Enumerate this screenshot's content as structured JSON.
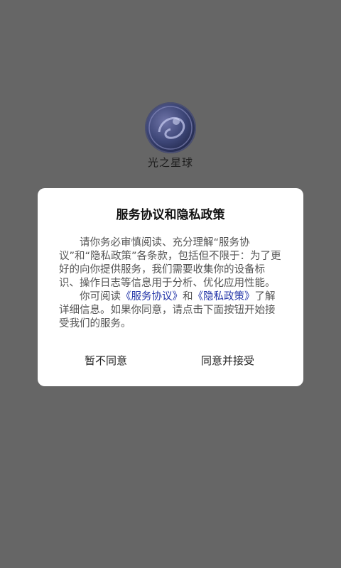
{
  "splash": {
    "app_name": "光之星球",
    "logo_icon": "planet-logo-icon"
  },
  "dialog": {
    "title": "服务协议和隐私政策",
    "paragraph1": "请你务必审慎阅读、充分理解“服务协议”和“隐私政策”各条款，包括但不限于：为了更好的向你提供服务，我们需要收集你的设备标识、操作日志等信息用于分析、优化应用性能。",
    "p2_prefix": "你可阅读",
    "service_link": "《服务协议》",
    "p2_and": "和",
    "privacy_link": "《隐私政策》",
    "p2_suffix": "了解详细信息。如果你同意，请点击下面按钮开始接受我们的服务。",
    "disagree_label": "暂不同意",
    "agree_label": "同意并接受"
  },
  "colors": {
    "overlay": "#666666",
    "link": "#2436a8",
    "dialog_bg": "#ffffff"
  }
}
